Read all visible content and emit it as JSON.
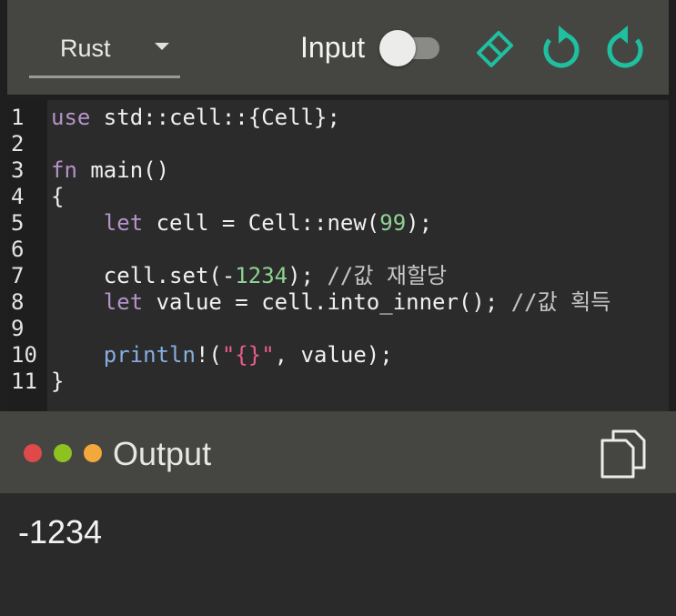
{
  "toolbar": {
    "language": "Rust",
    "input_label": "Input",
    "input_toggle": "off",
    "icons": [
      "eraser-icon",
      "undo-icon",
      "redo-icon"
    ],
    "accent_color": "#1fbf9f"
  },
  "editor": {
    "line_numbers": [
      "1",
      "2",
      "3",
      "4",
      "5",
      "6",
      "7",
      "8",
      "9",
      "10",
      "11"
    ],
    "lines": [
      [
        {
          "t": "use",
          "c": "kw"
        },
        {
          "t": " std::cell::{Cell};"
        }
      ],
      [],
      [
        {
          "t": "fn",
          "c": "kw"
        },
        {
          "t": " main()"
        }
      ],
      [
        {
          "t": "{"
        }
      ],
      [
        {
          "t": "    "
        },
        {
          "t": "let",
          "c": "kw"
        },
        {
          "t": " cell = Cell::new("
        },
        {
          "t": "99",
          "c": "num"
        },
        {
          "t": ");"
        }
      ],
      [],
      [
        {
          "t": "    cell.set(-"
        },
        {
          "t": "1234",
          "c": "num"
        },
        {
          "t": "); "
        },
        {
          "t": "//값 재할당",
          "c": "cmt"
        }
      ],
      [
        {
          "t": "    "
        },
        {
          "t": "let",
          "c": "kw"
        },
        {
          "t": " value = cell.into_inner(); "
        },
        {
          "t": "//값 획득",
          "c": "cmt"
        }
      ],
      [],
      [
        {
          "t": "    "
        },
        {
          "t": "println",
          "c": "macro"
        },
        {
          "t": "!("
        },
        {
          "t": "\"{}\"",
          "c": "str"
        },
        {
          "t": ", value);"
        }
      ],
      [
        {
          "t": "}"
        }
      ]
    ]
  },
  "output": {
    "title": "Output",
    "dots": [
      "#e0494a",
      "#8ec21f",
      "#f2a83a"
    ],
    "copy_icon": "copy-icon",
    "text": "-1234"
  }
}
